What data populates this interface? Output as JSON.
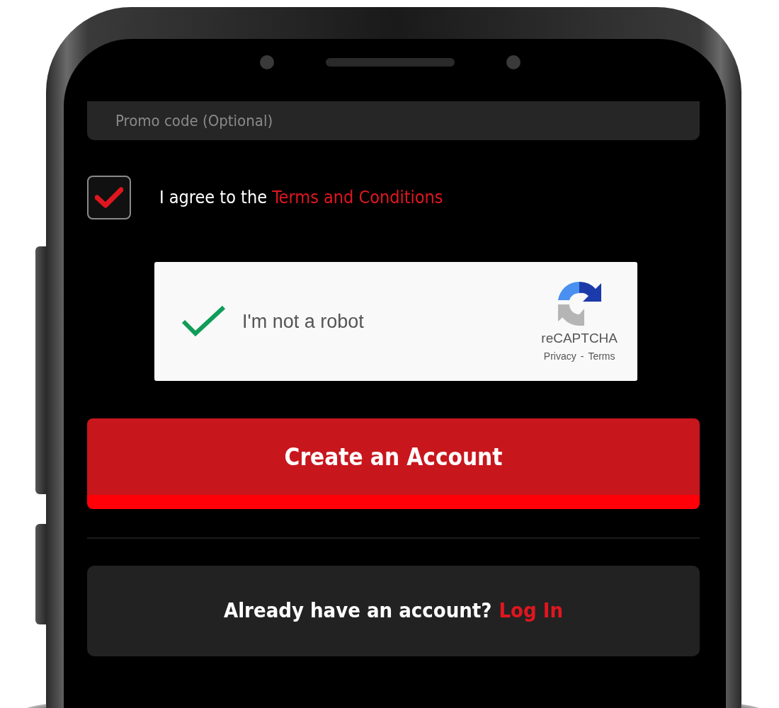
{
  "promo_field": {
    "placeholder": "Promo code (Optional)"
  },
  "terms": {
    "checked": true,
    "label": "I agree to the",
    "link": "Terms and Conditions"
  },
  "captcha": {
    "checked": true,
    "label": "I'm not a robot",
    "brand": "reCAPTCHA",
    "privacy": "Privacy",
    "separator": "-",
    "terms": "Terms"
  },
  "submit_button": "Create an Account",
  "login": {
    "prompt": "Already have an account?",
    "link": "Log In"
  }
}
